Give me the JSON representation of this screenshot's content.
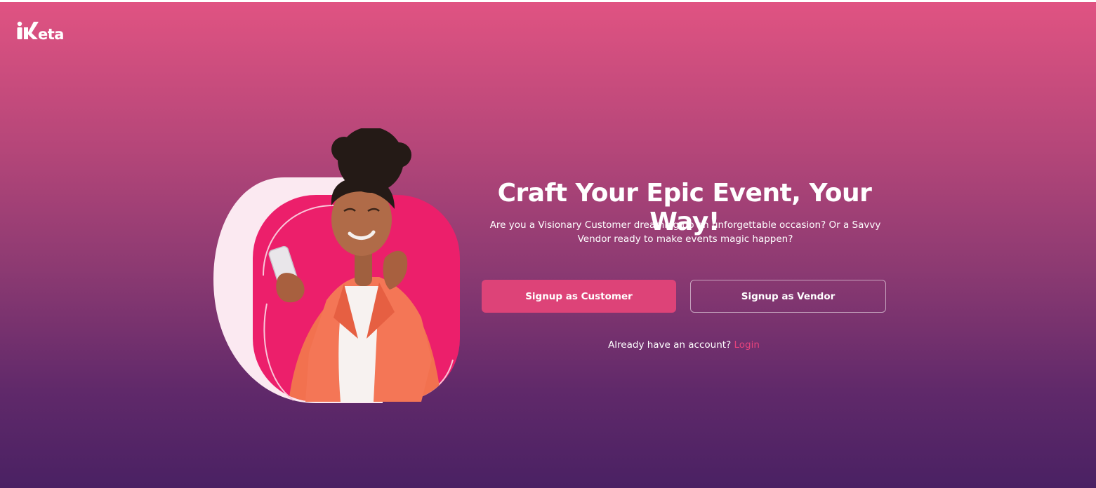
{
  "brand": {
    "logo_text": "Keta",
    "accent_color": "#dd4378"
  },
  "hero": {
    "headline": "Craft Your Epic Event, Your Way!",
    "subtext": "Are you a Visionary Customer dreaming up an unforgettable occasion? Or a Savvy Vendor ready to make events magic happen?"
  },
  "actions": {
    "customer_label": "Signup as Customer",
    "vendor_label": "Signup as Vendor"
  },
  "login": {
    "prompt": "Already have an account?",
    "link_label": "Login"
  }
}
